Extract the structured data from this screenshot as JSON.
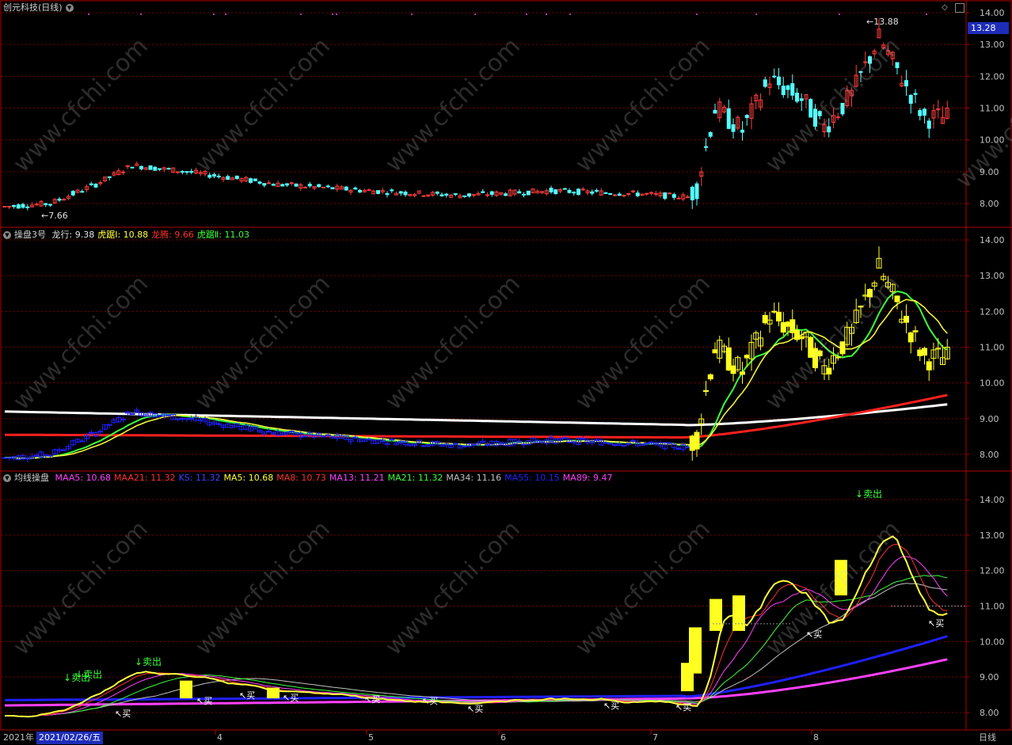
{
  "panel1": {
    "title": "创元科技(日线)",
    "high_label": "13.88",
    "low_label": "7.66",
    "current_price": "13.28",
    "axis": [
      "14.00",
      "13.00",
      "12.00",
      "11.00",
      "10.00",
      "9.00",
      "8.00"
    ]
  },
  "panel2": {
    "title": "操盘3号",
    "items": [
      {
        "label": "龙行: 9.38",
        "color": "#e0e0e0"
      },
      {
        "label": "虎踞Ⅰ: 10.88",
        "color": "#ffff3c"
      },
      {
        "label": "龙腾: 9.66",
        "color": "#ff3030"
      },
      {
        "label": "虎踞Ⅱ: 11.03",
        "color": "#3cff3c"
      }
    ],
    "axis": [
      "14.00",
      "13.00",
      "12.00",
      "11.00",
      "10.00",
      "9.00",
      "8.00"
    ]
  },
  "panel3": {
    "title": "均线操盘",
    "items": [
      {
        "label": "MAA5: 10.68",
        "color": "#ff40ff"
      },
      {
        "label": "MAA21: 11.32",
        "color": "#ff3030"
      },
      {
        "label": "KS: 11.32",
        "color": "#4040ff"
      },
      {
        "label": "MA5: 10.68",
        "color": "#ffff3c"
      },
      {
        "label": "MA8: 10.73",
        "color": "#ff3030"
      },
      {
        "label": "MA13: 11.21",
        "color": "#ff40ff"
      },
      {
        "label": "MA21: 11.32",
        "color": "#3cff3c"
      },
      {
        "label": "MA34: 11.16",
        "color": "#c0c0c0"
      },
      {
        "label": "MA55: 10.15",
        "color": "#2020ff"
      },
      {
        "label": "MA89: 9.47",
        "color": "#ff40ff"
      }
    ],
    "axis": [
      "14.00",
      "13.00",
      "12.00",
      "11.00",
      "10.00",
      "9.00",
      "8.00"
    ],
    "sell_label": "卖出",
    "buy_label": "买"
  },
  "xaxis": {
    "year": "2021年",
    "date": "2021/02/26/五",
    "months": [
      "4",
      "5",
      "6",
      "7",
      "8"
    ],
    "period": "日线"
  },
  "watermark": "www.cfchi.com",
  "colors": {
    "up": "#ff3c3c",
    "down": "#54ffff",
    "grid": "#7a0000",
    "border": "#b00000",
    "price_box": "#1d2db8"
  }
}
